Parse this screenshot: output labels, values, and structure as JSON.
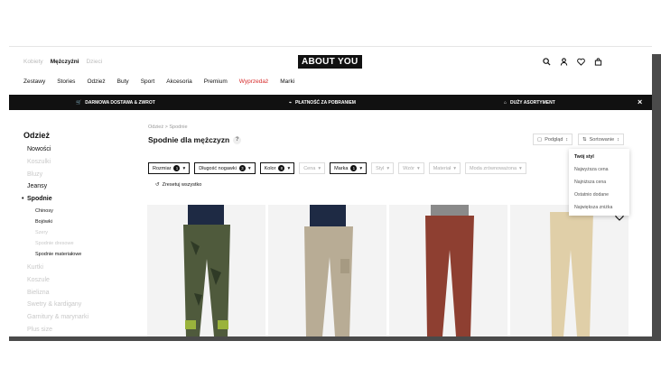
{
  "gender_tabs": [
    {
      "label": "Kobiety",
      "active": false
    },
    {
      "label": "Mężczyźni",
      "active": true
    },
    {
      "label": "Dzieci",
      "active": false
    }
  ],
  "logo": "ABOUT YOU",
  "header_icons": [
    "search-icon",
    "user-icon",
    "heart-icon",
    "bag-icon"
  ],
  "nav": [
    "Zestawy",
    "Stories",
    "Odzież",
    "Buty",
    "Sport",
    "Akcesoria",
    "Premium",
    "Wyprzedaż",
    "Marki"
  ],
  "promo": [
    "DARMOWA DOSTAWA & ZWROT",
    "PŁATNOŚĆ ZA POBRANIEM",
    "DUŻY ASORTYMENT"
  ],
  "sidebar": {
    "title": "Odzież",
    "items": [
      {
        "label": "Nowości",
        "state": "normal"
      },
      {
        "label": "Koszulki",
        "state": "faint"
      },
      {
        "label": "Bluzy",
        "state": "faint"
      },
      {
        "label": "Jeansy",
        "state": "normal"
      },
      {
        "label": "Spodnie",
        "state": "current"
      }
    ],
    "subitems": [
      {
        "label": "Chinosy",
        "state": "normal"
      },
      {
        "label": "Bojówki",
        "state": "normal"
      },
      {
        "label": "Szery",
        "state": "faint"
      },
      {
        "label": "Spodnie dresowe",
        "state": "faint"
      },
      {
        "label": "Spodnie materiałowe",
        "state": "normal"
      }
    ],
    "more": [
      "Kurtki",
      "Koszule",
      "Bielizna",
      "Swetry & kardigany",
      "Garnitury & marynarki",
      "Plus size"
    ]
  },
  "breadcrumb": "Odzież > Spodnie",
  "title": "Spodnie dla mężczyzn",
  "view_label": "Podgląd",
  "sort_label": "Sortowanie",
  "filters": [
    {
      "label": "Rozmiar",
      "count": "1",
      "active": true
    },
    {
      "label": "Długość nogawki",
      "count": "3",
      "active": true
    },
    {
      "label": "Kolor",
      "count": "8",
      "active": true
    },
    {
      "label": "Cena",
      "count": "",
      "active": false
    },
    {
      "label": "Marka",
      "count": "1",
      "active": true
    },
    {
      "label": "Styl",
      "count": "",
      "active": false
    },
    {
      "label": "Wzór",
      "count": "",
      "active": false
    },
    {
      "label": "Materiał",
      "count": "",
      "active": false
    },
    {
      "label": "Moda zrównoważona",
      "count": "",
      "active": false
    }
  ],
  "reset_label": "Zresetuj wszystko",
  "sort_options": [
    "Twój styl",
    "Najwyższa cena",
    "Najniższa cena",
    "Ostatnio dodane",
    "Największa zniżka"
  ],
  "products": [
    {
      "pants": "#4f5a3c",
      "shirt": "#1e2a44"
    },
    {
      "pants": "#b8ac95",
      "shirt": "#1e2a44"
    },
    {
      "pants": "#8e3f31",
      "shirt": "#8a8a8a"
    },
    {
      "pants": "#e0cfa8",
      "shirt": ""
    }
  ]
}
